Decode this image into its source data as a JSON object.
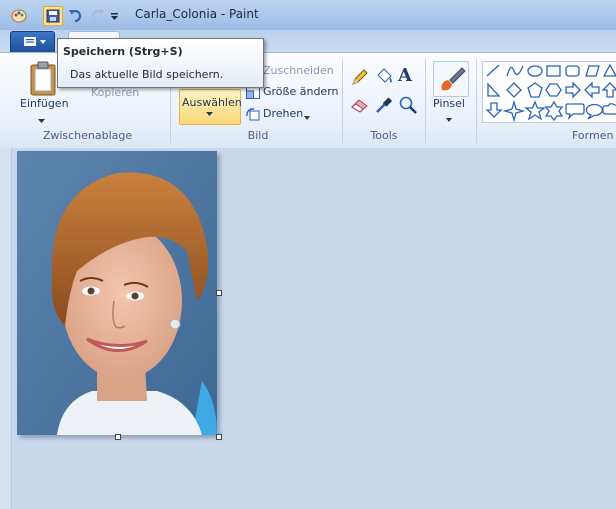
{
  "window": {
    "title": "Carla_Colonia - Paint"
  },
  "tooltip": {
    "title": "Speichern (Strg+S)",
    "body": "Das aktuelle Bild speichern."
  },
  "ribbon": {
    "clipboard": {
      "paste_label": "Einfügen",
      "copy_label": "Kopieren",
      "group_label": "Zwischenablage"
    },
    "image": {
      "select_label": "Auswählen",
      "crop_label": "Zuschneiden",
      "resize_label": "Größe ändern",
      "rotate_label": "Drehen",
      "group_label": "Bild"
    },
    "tools": {
      "group_label": "Tools"
    },
    "brushes": {
      "label": "Pinsel"
    },
    "shapes": {
      "group_label": "Formen"
    }
  },
  "icons": {
    "quick_access": [
      "paint-app-icon",
      "save-icon",
      "undo-icon",
      "redo-icon",
      "customize-dropdown-icon"
    ],
    "tools": [
      "pencil-icon",
      "fill-bucket-icon",
      "text-icon",
      "eraser-icon",
      "color-picker-icon",
      "magnifier-icon"
    ],
    "shapes": [
      "line",
      "curve",
      "oval",
      "rectangle",
      "rounded-rectangle",
      "polygon",
      "triangle",
      "right-triangle",
      "diamond",
      "pentagon",
      "hexagon",
      "right-arrow",
      "left-arrow",
      "up-arrow",
      "down-arrow",
      "four-point-star",
      "five-point-star",
      "six-point-star",
      "rounded-callout",
      "oval-callout",
      "cloud-callout"
    ]
  },
  "colors": {
    "selected_button": "#fde28a",
    "workspace": "#cad8eb",
    "accent": "#2a63b8"
  }
}
